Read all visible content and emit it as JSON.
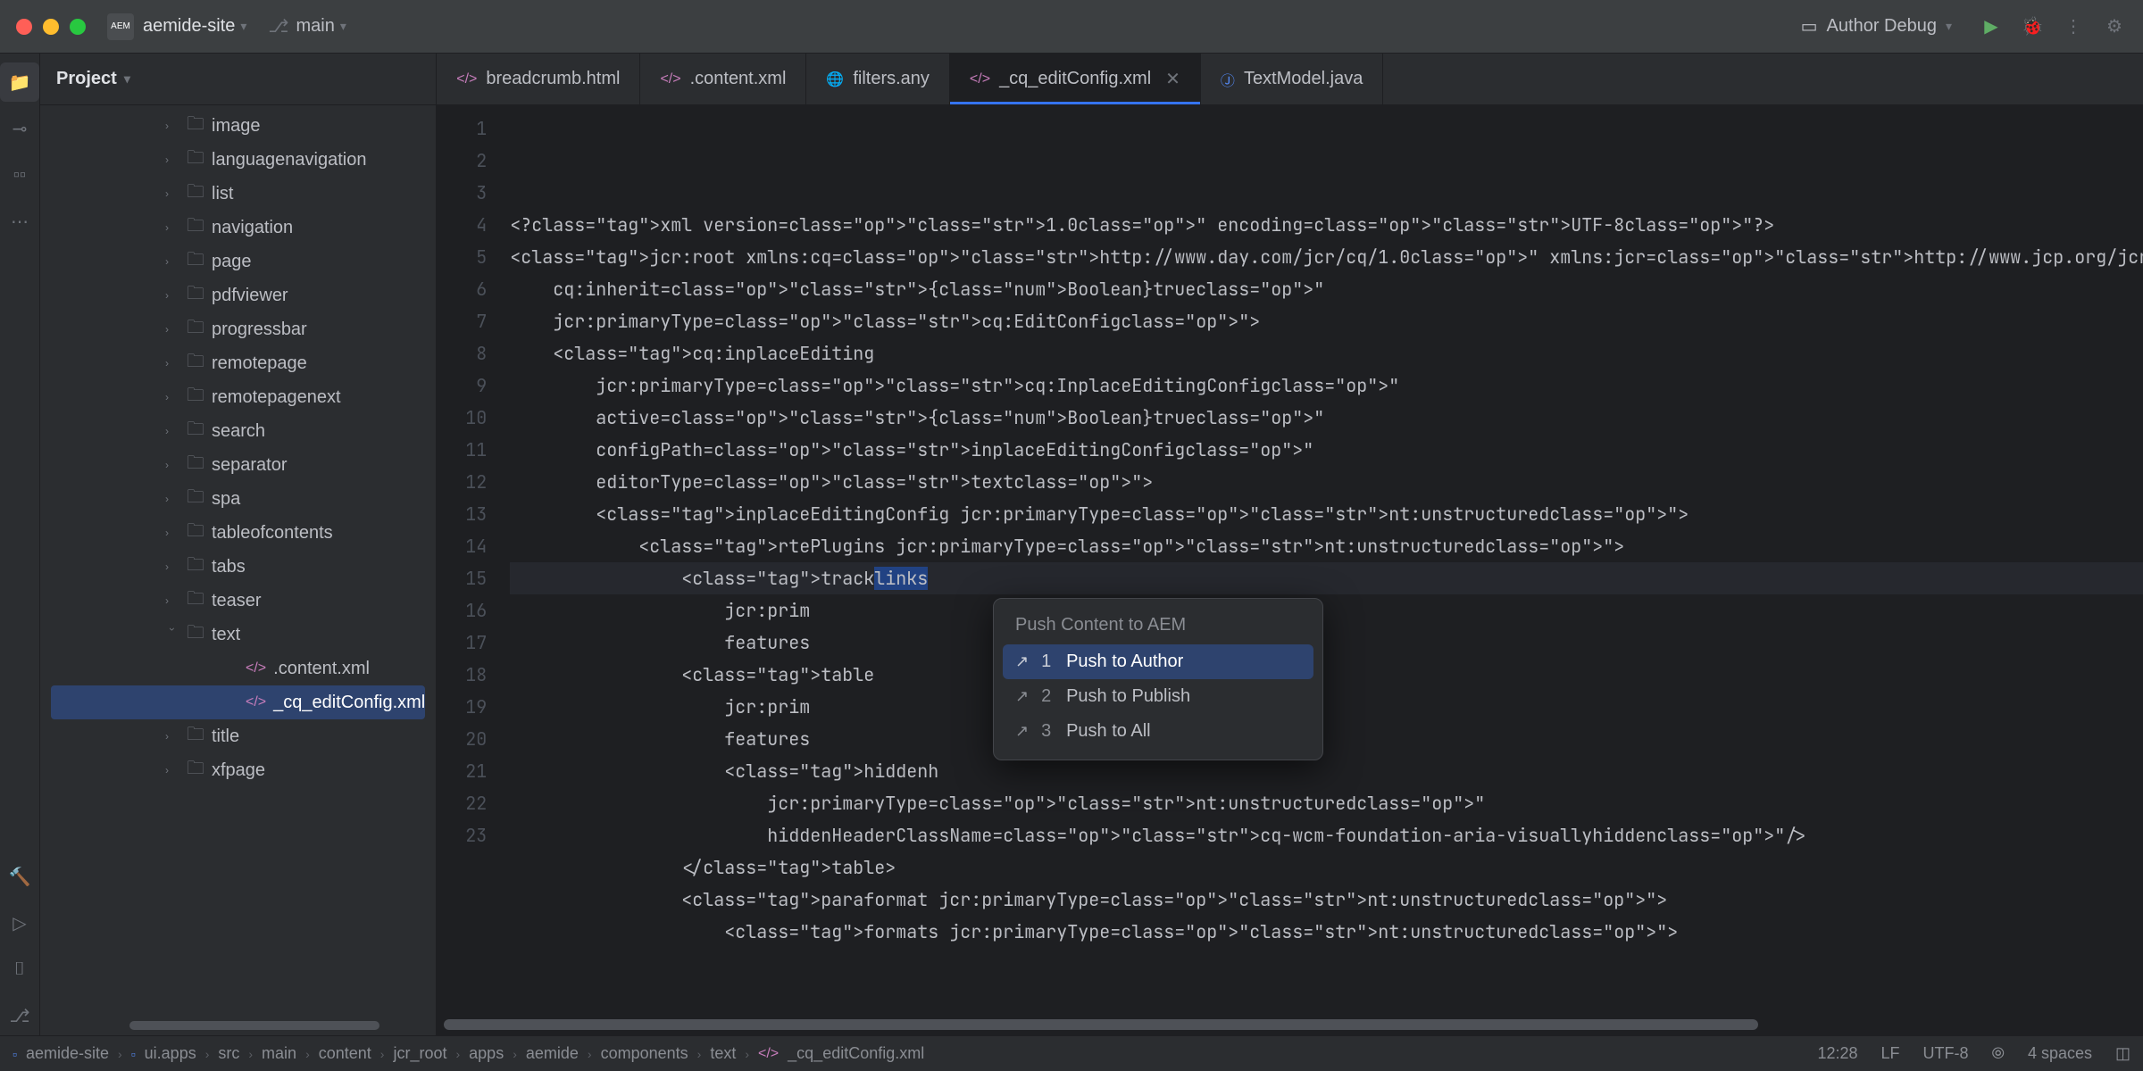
{
  "titlebar": {
    "project_name": "aemide-site",
    "branch": "main",
    "run_config": "Author Debug"
  },
  "project_panel": {
    "title": "Project",
    "items": [
      {
        "label": "image",
        "expanded": false
      },
      {
        "label": "languagenavigation",
        "expanded": false
      },
      {
        "label": "list",
        "expanded": false
      },
      {
        "label": "navigation",
        "expanded": false
      },
      {
        "label": "page",
        "expanded": false
      },
      {
        "label": "pdfviewer",
        "expanded": false
      },
      {
        "label": "progressbar",
        "expanded": false
      },
      {
        "label": "remotepage",
        "expanded": false
      },
      {
        "label": "remotepagenext",
        "expanded": false
      },
      {
        "label": "search",
        "expanded": false
      },
      {
        "label": "separator",
        "expanded": false
      },
      {
        "label": "spa",
        "expanded": false
      },
      {
        "label": "tableofcontents",
        "expanded": false
      },
      {
        "label": "tabs",
        "expanded": false
      },
      {
        "label": "teaser",
        "expanded": false
      },
      {
        "label": "text",
        "expanded": true,
        "children": [
          {
            "label": ".content.xml",
            "type": "xml"
          },
          {
            "label": "_cq_editConfig.xml",
            "type": "xml",
            "selected": true
          }
        ]
      },
      {
        "label": "title",
        "expanded": false
      },
      {
        "label": "xfpage",
        "expanded": false
      }
    ]
  },
  "tabs": [
    {
      "label": "breadcrumb.html",
      "icon": "purple"
    },
    {
      "label": ".content.xml",
      "icon": "purple"
    },
    {
      "label": "filters.any",
      "icon": "green"
    },
    {
      "label": "_cq_editConfig.xml",
      "icon": "purple",
      "active": true,
      "closeable": true
    },
    {
      "label": "TextModel.java",
      "icon": "blue"
    }
  ],
  "editor": {
    "lines": [
      "<?xml version=\"1.0\" encoding=\"UTF-8\"?>",
      "<jcr:root xmlns:cq=\"http://www.day.com/jcr/cq/1.0\" xmlns:jcr=\"http://www.jcp.org/jcr/1.0\" xmlns:nt=\"http://www.",
      "    cq:inherit=\"{Boolean}true\"",
      "    jcr:primaryType=\"cq:EditConfig\">",
      "    <cq:inplaceEditing",
      "        jcr:primaryType=\"cq:InplaceEditingConfig\"",
      "        active=\"{Boolean}true\"",
      "        configPath=\"inplaceEditingConfig\"",
      "        editorType=\"text\">",
      "        <inplaceEditingConfig jcr:primaryType=\"nt:unstructured\">",
      "            <rtePlugins jcr:primaryType=\"nt:unstructured\">",
      "                <tracklinks",
      "                    jcr:prim",
      "                    features",
      "                <table",
      "                    jcr:prim",
      "                    features",
      "                    <hiddenh",
      "                        jcr:primaryType=\"nt:unstructured\"",
      "                        hiddenHeaderClassName=\"cq-wcm-foundation-aria-visuallyhidden\"/>",
      "                </table>",
      "                <paraformat jcr:primaryType=\"nt:unstructured\">",
      "                    <formats jcr:primaryType=\"nt:unstructured\">"
    ],
    "current_line": 12,
    "selected_text": "links"
  },
  "popup": {
    "title": "Push Content to AEM",
    "items": [
      {
        "num": "1",
        "label": "Push to Author",
        "selected": true
      },
      {
        "num": "2",
        "label": "Push to Publish"
      },
      {
        "num": "3",
        "label": "Push to All"
      }
    ]
  },
  "breadcrumbs": [
    "aemide-site",
    "ui.apps",
    "src",
    "main",
    "content",
    "jcr_root",
    "apps",
    "aemide",
    "components",
    "text",
    "_cq_editConfig.xml"
  ],
  "status": {
    "caret": "12:28",
    "line_sep": "LF",
    "encoding": "UTF-8",
    "indent": "4 spaces"
  }
}
